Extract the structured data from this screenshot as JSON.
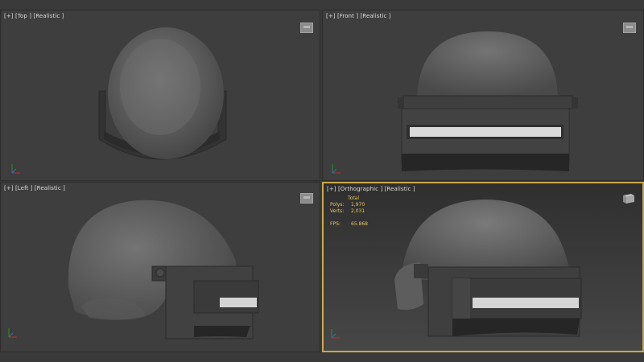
{
  "viewports": {
    "top": {
      "label": "[+] [Top ] [Realistic ]"
    },
    "front": {
      "label": "[+] [Front ] [Realistic ]"
    },
    "left": {
      "label": "[+] [Left ] [Realistic ]"
    },
    "perspective": {
      "label": "[+] [Orthographic ] [Realistic ]"
    }
  },
  "stats": {
    "header": "Total",
    "polys_label": "Polys:",
    "polys_value": "1,970",
    "verts_label": "Verts:",
    "verts_value": "2,031",
    "fps_label": "FPS:",
    "fps_value": "65.868"
  },
  "colors": {
    "active_border": "#c8a84a",
    "stats_text": "#e7c75a",
    "viewport_bg": "#3e3e3e"
  },
  "icons": [
    "viewcube-icon",
    "axis-tripod-icon"
  ]
}
